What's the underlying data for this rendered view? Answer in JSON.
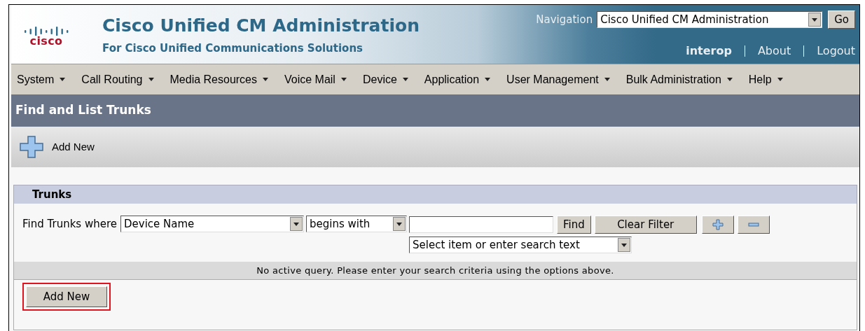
{
  "header": {
    "logo": "cisco",
    "title": "Cisco Unified CM Administration",
    "subtitle": "For Cisco Unified Communications Solutions",
    "navigation_label": "Navigation",
    "navigation_value": "Cisco Unified CM Administration",
    "go_button": "Go",
    "user": "interop",
    "links": [
      "About",
      "Logout"
    ]
  },
  "menu": [
    "System",
    "Call Routing",
    "Media Resources",
    "Voice Mail",
    "Device",
    "Application",
    "User Management",
    "Bulk Administration",
    "Help"
  ],
  "page_title": "Find and List Trunks",
  "toolbar": {
    "add_new": "Add New"
  },
  "panel": {
    "title": "Trunks",
    "find_label": "Find Trunks where",
    "field_select": "Device Name",
    "operator_select": "begins with",
    "search_select": "Select item or enter search text",
    "find_button": "Find",
    "clear_button": "Clear Filter",
    "message": "No active query. Please enter your search criteria using the options above.",
    "add_button": {
      "label": "Add New",
      "highlighted": true
    }
  }
}
